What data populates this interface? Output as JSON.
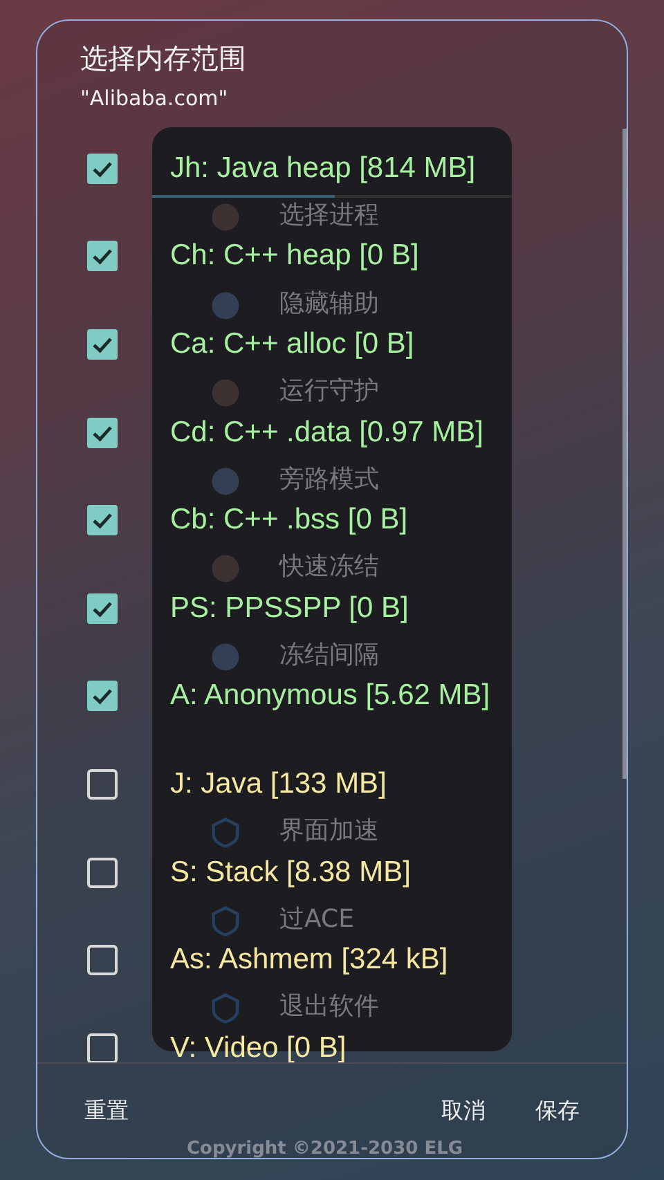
{
  "background_menu": {
    "items_upper": [
      {
        "label": "选择进程"
      },
      {
        "label": "隐藏辅助"
      },
      {
        "label": "运行守护"
      },
      {
        "label": "旁路模式"
      },
      {
        "label": "快速冻结"
      },
      {
        "label": "冻结间隔"
      }
    ],
    "items_lower": [
      {
        "label": "界面加速"
      },
      {
        "label": "过ACE"
      },
      {
        "label": "退出软件"
      }
    ],
    "copyright": "Copyright ©2021-2030 ELG"
  },
  "dialog": {
    "title": "选择内存范围",
    "subtitle": "\"Alibaba.com\"",
    "ranges": [
      {
        "label": "Jh: Java heap [814 MB]",
        "checked": true
      },
      {
        "label": "Ch: C++ heap [0 B]",
        "checked": true
      },
      {
        "label": "Ca: C++ alloc [0 B]",
        "checked": true
      },
      {
        "label": "Cd: C++ .data [0.97 MB]",
        "checked": true
      },
      {
        "label": "Cb: C++ .bss [0 B]",
        "checked": true
      },
      {
        "label": "PS: PPSSPP [0 B]",
        "checked": true
      },
      {
        "label": "A: Anonymous [5.62 MB]",
        "checked": true
      },
      {
        "label": "J: Java [133 MB]",
        "checked": false
      },
      {
        "label": "S: Stack [8.38 MB]",
        "checked": false
      },
      {
        "label": "As: Ashmem [324 kB]",
        "checked": false
      },
      {
        "label": "V: Video [0 B]",
        "checked": false
      }
    ],
    "buttons": {
      "left": "重置",
      "cancel": "取消",
      "save": "保存"
    }
  }
}
